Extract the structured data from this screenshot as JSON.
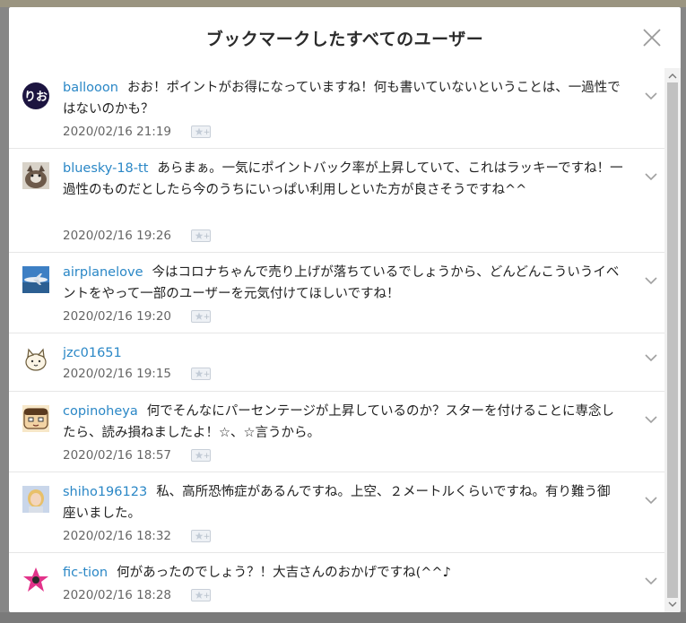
{
  "modal": {
    "title": "ブックマークしたすべてのユーザー"
  },
  "comments": [
    {
      "username": "ballooon",
      "text": "おお！ポイントがお得になっていますね！何も書いていないということは、一過性ではないのかも？",
      "date": "2020/02/16 21:19",
      "avatar_label": "りお"
    },
    {
      "username": "bluesky-18-tt",
      "text": "あらまぁ。一気にポイントバック率が上昇していて、これはラッキーですね！一過性のものだとしたら今のうちにいっぱい利用しといた方が良さそうですね^^",
      "date": "2020/02/16 19:26"
    },
    {
      "username": "airplanelove",
      "text": "今はコロナちゃんで売り上げが落ちているでしょうから、どんどんこういうイベントをやって一部のユーザーを元気付けてほしいですね！",
      "date": "2020/02/16 19:20"
    },
    {
      "username": "jzc01651",
      "text": "",
      "date": "2020/02/16 19:15"
    },
    {
      "username": "copinoheya",
      "text": "何でそんなにパーセンテージが上昇しているのか？スターを付けることに専念したら、読み損ねましたよ！☆、☆言うから。",
      "date": "2020/02/16 18:57"
    },
    {
      "username": "shiho196123",
      "text": "私、高所恐怖症があるんですね。上空、２メートルくらいですね。有り難う御座いました。",
      "date": "2020/02/16 18:32"
    },
    {
      "username": "fic-tion",
      "text": "何があったのでしょう？！大吉さんのおかげですね(^^♪",
      "date": "2020/02/16 18:28"
    }
  ]
}
